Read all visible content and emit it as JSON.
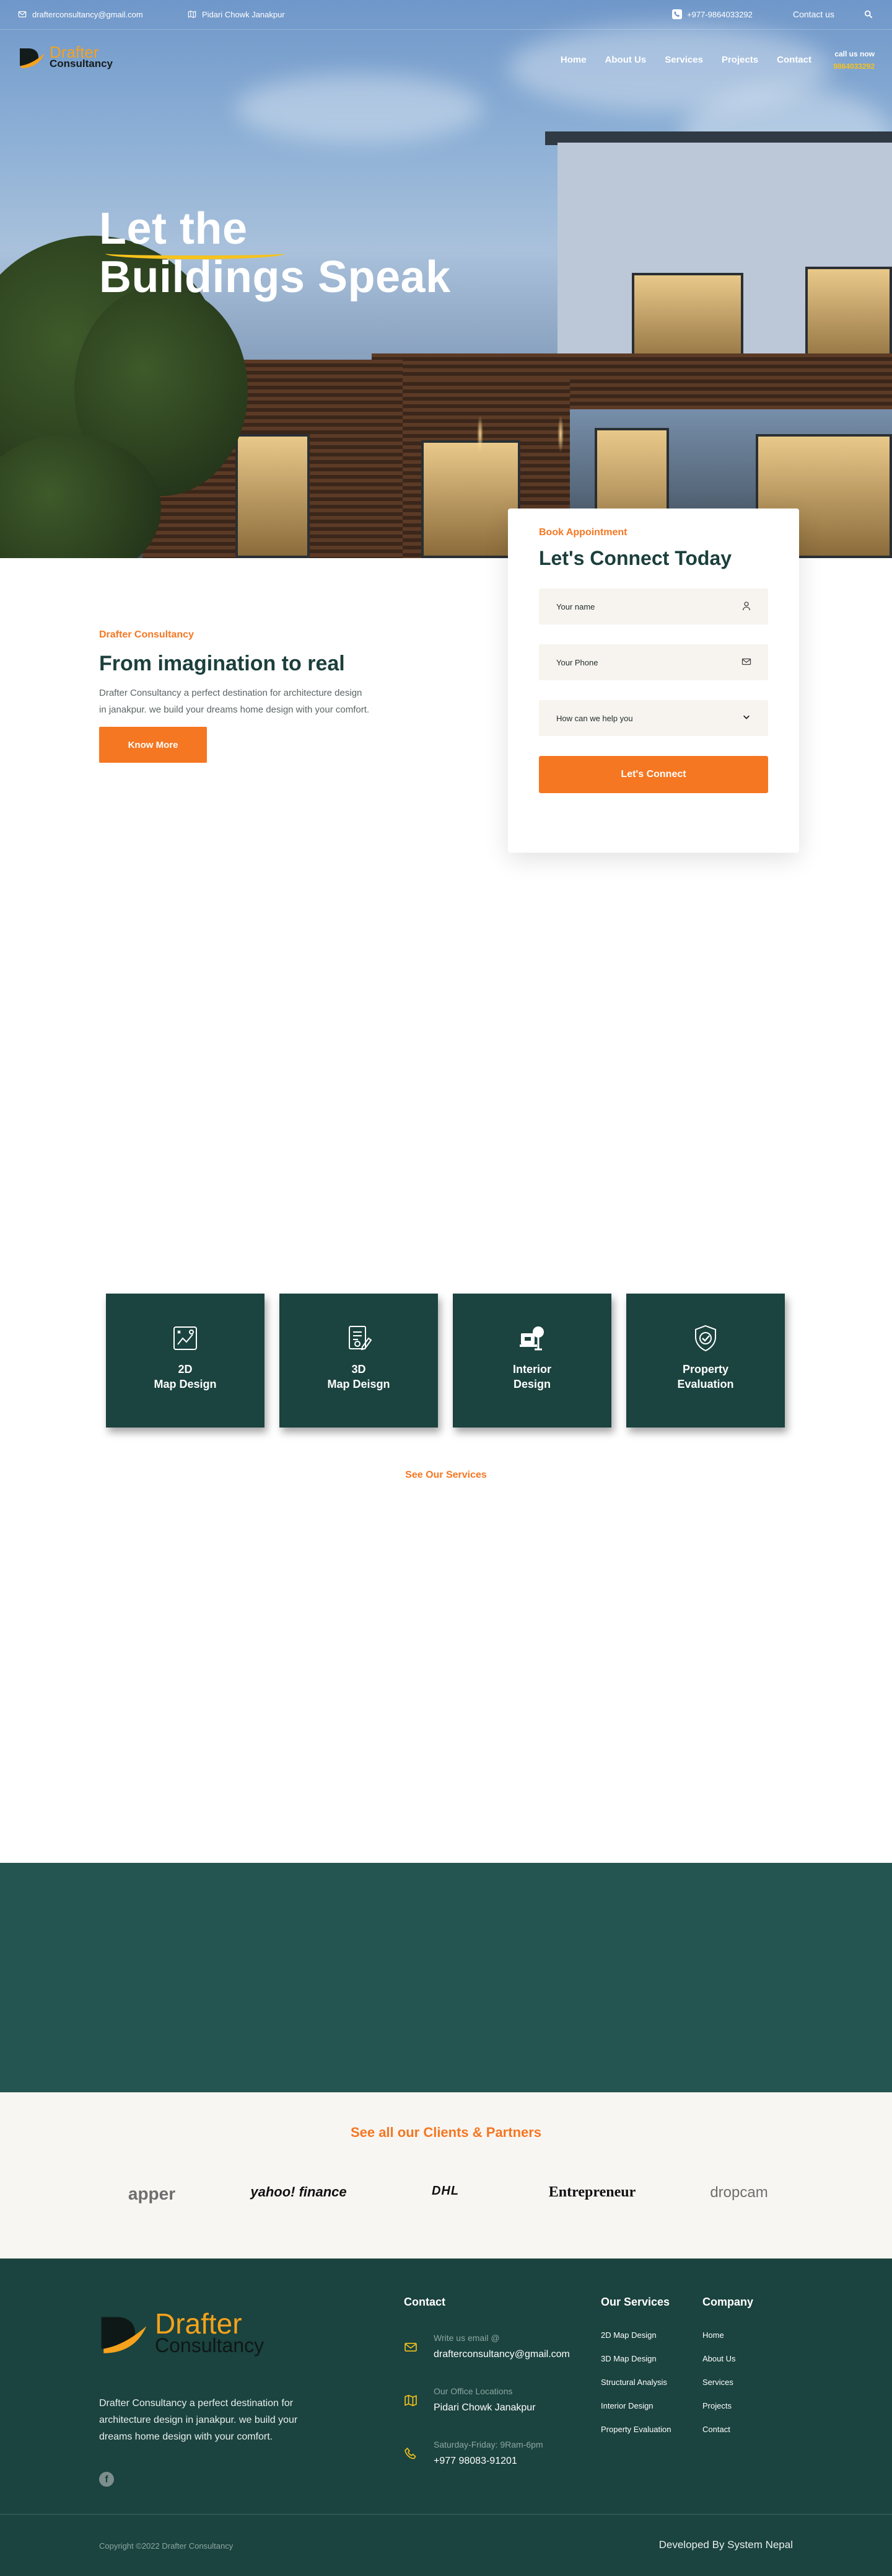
{
  "topbar": {
    "email": "drafterconsultancy@gmail.com",
    "location": "Pidari Chowk Janakpur",
    "phone": "+977-9864033292",
    "contact_link": "Contact us"
  },
  "nav": {
    "logo_line1": "Drafter",
    "logo_line2": "Consultancy",
    "items": [
      "Home",
      "About Us",
      "Services",
      "Projects",
      "Contact"
    ],
    "call_label": "call us now",
    "call_number": "9864033292"
  },
  "hero": {
    "title_line1": "Let the",
    "title_line2": "Buildings Speak"
  },
  "appointment": {
    "kicker": "Book Appointment",
    "title": "Let's Connect Today",
    "name_placeholder": "Your name",
    "phone_placeholder": "Your Phone",
    "help_placeholder": "How can we help you",
    "button": "Let's Connect"
  },
  "intro": {
    "kicker": "Drafter Consultancy",
    "title": "From imagination to real",
    "text": "Drafter Consultancy a perfect destination for architecture design in janakpur. we build your dreams home design with your comfort.",
    "button": "Know More"
  },
  "services": {
    "items": [
      {
        "name": "2D\nMap Design",
        "icon": "map-2d-icon"
      },
      {
        "name": "3D\nMap Deisgn",
        "icon": "map-3d-icon"
      },
      {
        "name": "Interior\nDesign",
        "icon": "interior-icon"
      },
      {
        "name": "Property\nEvaluation",
        "icon": "shield-check-icon"
      }
    ],
    "see_all": "See Our Services"
  },
  "partners": {
    "title": "See all our Clients & Partners",
    "logos": [
      "apper",
      "yahoo! finance",
      "DHL",
      "Entrepreneur",
      "dropcam"
    ]
  },
  "footer": {
    "logo_line1": "Drafter",
    "logo_line2": "Consultancy",
    "description": "Drafter Consultancy a perfect destination for architecture design in janakpur. we build your dreams home design with your comfort.",
    "contact_title": "Contact",
    "contacts": [
      {
        "label": "Write us email @",
        "value": "drafterconsultancy@gmail.com",
        "icon": "mail-icon"
      },
      {
        "label": "Our Office Locations",
        "value": "Pidari Chowk Janakpur",
        "icon": "map-icon"
      },
      {
        "label": "Saturday-Friday: 9Ram-6pm",
        "value": "+977 98083-91201",
        "icon": "phone-icon"
      }
    ],
    "services_title": "Our Services",
    "services_links": [
      "2D Map Design",
      "3D Map Design",
      "Structural Analysis",
      "Interior Design",
      "Property Evaluation"
    ],
    "company_title": "Company",
    "company_links": [
      "Home",
      "About Us",
      "Services",
      "Projects",
      "Contact"
    ],
    "copyright": "Copyright ©2022 Drafter Consultancy",
    "developed_by": "Developed By System Nepal"
  },
  "colors": {
    "accent": "#f57722",
    "brand_yellow": "#f6a21c",
    "dark_teal": "#1b433f",
    "band_teal": "#245550"
  }
}
